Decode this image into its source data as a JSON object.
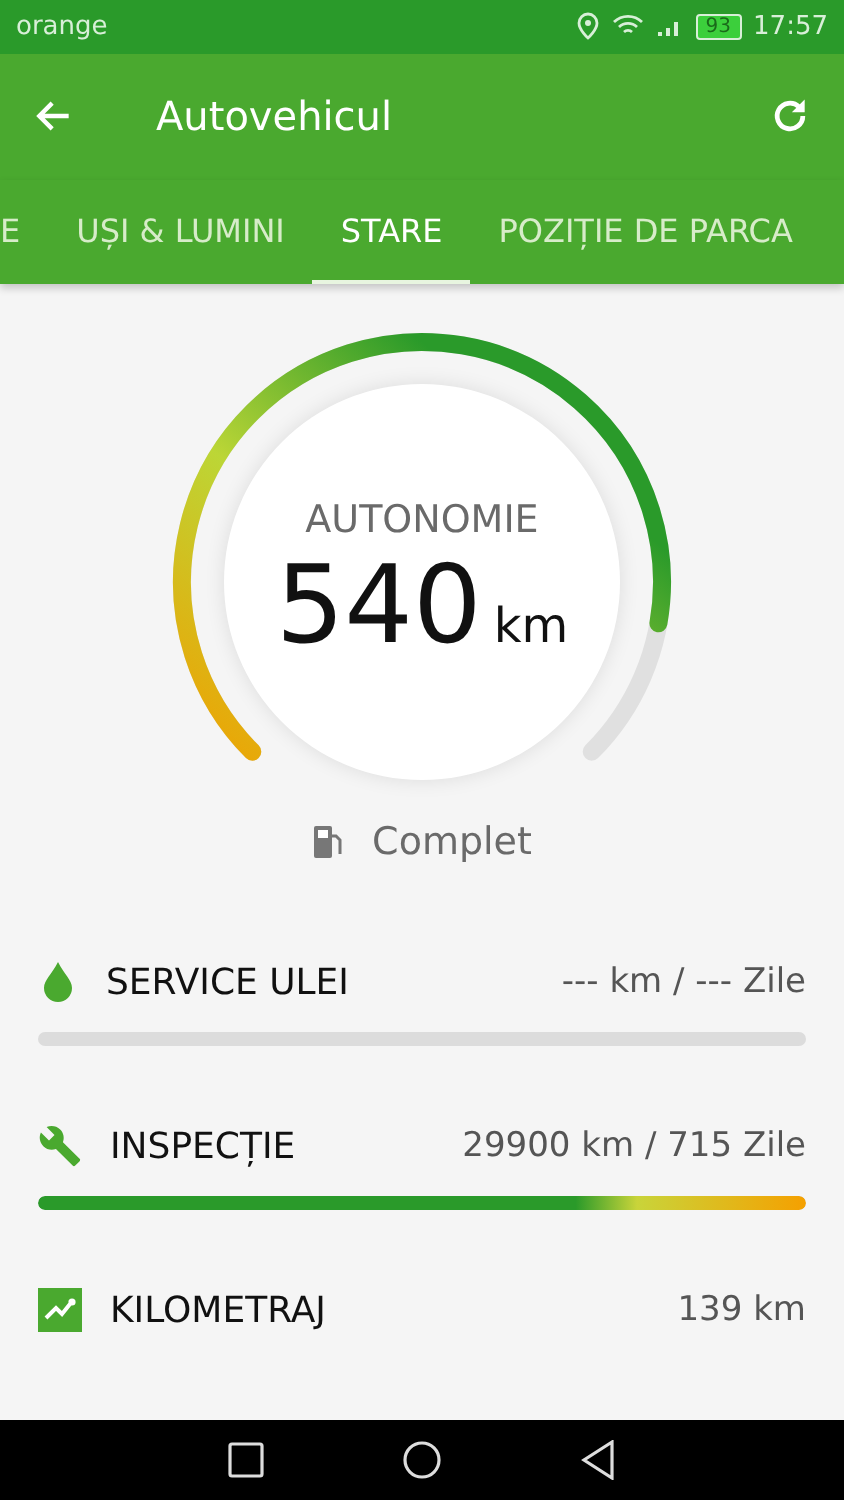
{
  "status_bar": {
    "carrier": "orange",
    "battery": "93",
    "time": "17:57"
  },
  "app_bar": {
    "title": "Autovehicul"
  },
  "tabs": [
    {
      "label": "E",
      "selected": false
    },
    {
      "label": "UȘI & LUMINI",
      "selected": false
    },
    {
      "label": "STARE",
      "selected": true
    },
    {
      "label": "POZIȚIE DE PARCA",
      "selected": false
    }
  ],
  "gauge": {
    "label": "AUTONOMIE",
    "value": "540",
    "unit": "km",
    "fuel": "Complet"
  },
  "items": [
    {
      "kind": "oil",
      "title": "SERVICE ULEI",
      "value": "--- km / --- Zile",
      "level": 0
    },
    {
      "kind": "inspection",
      "title": "INSPECȚIE",
      "value": "29900 km / 715 Zile",
      "level": 1
    },
    {
      "kind": "mileage",
      "title": "KILOMETRAJ",
      "value": "139 km"
    }
  ]
}
